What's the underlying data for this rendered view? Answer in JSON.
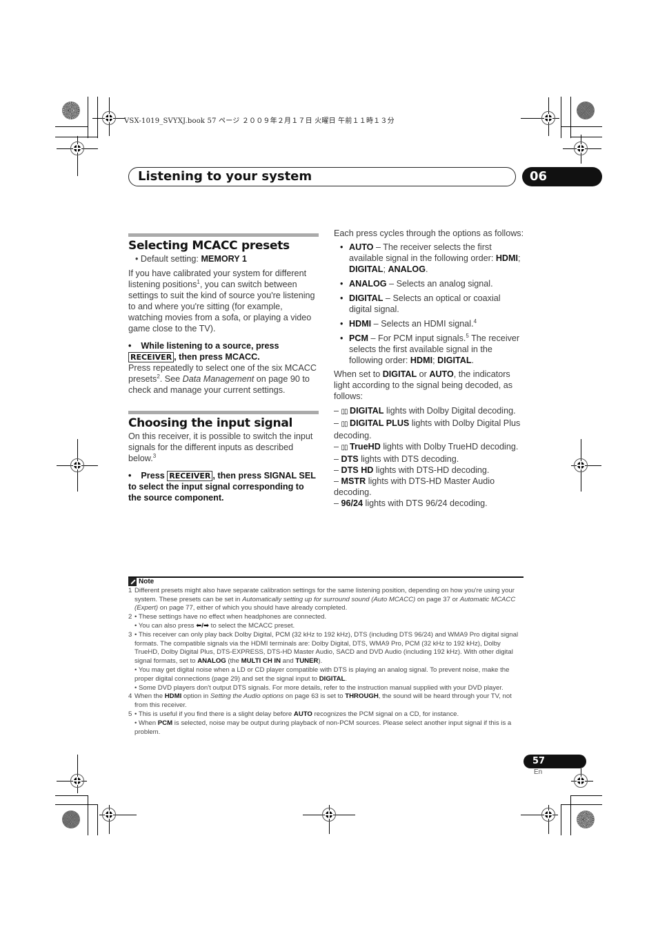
{
  "slug": "VSX-1019_SVYXJ.book  57 ページ  ２００９年２月１７日  火曜日  午前１１時１３分",
  "chapter": {
    "title": "Listening to your system",
    "number": "06"
  },
  "section1": {
    "heading": "Selecting MCACC presets",
    "default_label": "Default setting: ",
    "default_value": "MEMORY 1",
    "para_a": "If you have calibrated your system for different listening positions",
    "para_a_sup": "1",
    "para_b": ", you can switch between settings to suit the kind of source you're listening to and where you're sitting (for example, watching movies from a sofa, or playing a video game close to the TV).",
    "inst_pre": "While listening to a source, press ",
    "inst_key": "RECEIVER",
    "inst_post": ", then press MCACC.",
    "after_a": "Press repeatedly to select one of the six MCACC presets",
    "after_sup": "2",
    "after_b": ". See ",
    "after_italic": "Data Management",
    "after_c": " on page 90 to check and manage your current settings."
  },
  "section2": {
    "heading": "Choosing the input signal",
    "para": "On this receiver, it is possible to switch the input signals for the different inputs as described below.",
    "para_sup": "3",
    "inst_pre": "Press ",
    "inst_key": "RECEIVER",
    "inst_post": ", then press SIGNAL SEL to select the input signal corresponding to the source component."
  },
  "right": {
    "intro": "Each press cycles through the options as follows:",
    "options": [
      {
        "name": "AUTO",
        "desc": " – The receiver selects the first available signal in the following order: ",
        "order": [
          "HDMI",
          "DIGITAL",
          "ANALOG"
        ],
        "sup": ""
      },
      {
        "name": "ANALOG",
        "desc": " – Selects an analog signal.",
        "order": [],
        "sup": ""
      },
      {
        "name": "DIGITAL",
        "desc": " – Selects an optical or coaxial digital signal.",
        "order": [],
        "sup": ""
      },
      {
        "name": "HDMI",
        "desc": " – Selects an HDMI signal.",
        "order": [],
        "sup": "4"
      },
      {
        "name": "PCM",
        "desc": " – For PCM input signals.",
        "order": [
          "HDMI",
          "DIGITAL"
        ],
        "sup": "5",
        "desc2": " The receiver selects the first available signal in the following order: "
      }
    ],
    "when_pre": "When set to ",
    "when_b1": "DIGITAL",
    "when_mid": " or ",
    "when_b2": "AUTO",
    "when_post": ", the indicators light according to the signal being decoded, as follows:",
    "indicators": [
      {
        "dolby": true,
        "label": "DIGITAL",
        "desc": " lights with Dolby Digital decoding."
      },
      {
        "dolby": true,
        "label": "DIGITAL PLUS",
        "desc": " lights with Dolby Digital Plus decoding."
      },
      {
        "dolby": true,
        "label": "TrueHD",
        "desc": " lights with Dolby TrueHD decoding."
      },
      {
        "dolby": false,
        "label": "DTS",
        "desc": " lights with DTS decoding."
      },
      {
        "dolby": false,
        "label": "DTS HD",
        "desc": " lights with DTS-HD decoding."
      },
      {
        "dolby": false,
        "label": "MSTR",
        "desc": " lights with DTS-HD Master Audio decoding."
      },
      {
        "dolby": false,
        "label": "96/24",
        "desc": " lights with DTS 96/24 decoding."
      }
    ]
  },
  "notes": {
    "heading": "Note",
    "n1_num": "1",
    "n1_a": "Different presets might also have separate calibration settings for the same listening position, depending on how you're using your system. These presets can be set in ",
    "n1_i1": "Automatically setting up for surround sound (Auto MCACC)",
    "n1_b": " on page 37 or ",
    "n1_i2": "Automatic MCACC (Expert)",
    "n1_c": " on page 77, either of which you should have already completed.",
    "n2_num": "2",
    "n2_a": "• These settings have no effect when headphones are connected.",
    "n2_b_pre": "• You can also press ",
    "n2_b_arrows": "⬅/➡",
    "n2_b_post": " to select the MCACC preset.",
    "n3_num": "3",
    "n3_a": "• This receiver can only play back Dolby Digital, PCM (32 kHz to 192 kHz), DTS (including DTS 96/24) and WMA9 Pro digital signal formats. The compatible signals via the HDMI terminals are: Dolby Digital, DTS, WMA9 Pro, PCM (32 kHz to 192 kHz), Dolby TrueHD, Dolby Digital Plus, DTS-EXPRESS, DTS-HD Master Audio, SACD and DVD Audio (including 192 kHz). With other digital signal formats, set to ",
    "n3_a_b1": "ANALOG",
    "n3_a_mid": " (the ",
    "n3_a_b2": "MULTI CH IN",
    "n3_a_and": " and ",
    "n3_a_b3": "TUNER",
    "n3_a_end": ").",
    "n3_b": "• You may get digital noise when a LD or CD player compatible with DTS is playing an analog signal. To prevent noise, make the proper digital connections (page 29) and set the signal input to ",
    "n3_b_b": "DIGITAL",
    "n3_b_end": ".",
    "n3_c": "• Some DVD players don't output DTS signals. For more details, refer to the instruction manual supplied with your DVD player.",
    "n4_num": "4",
    "n4_a": "When the ",
    "n4_b1": "HDMI",
    "n4_b": " option in ",
    "n4_i": "Setting the Audio options",
    "n4_c": " on page 63 is set to ",
    "n4_b2": "THROUGH",
    "n4_d": ", the sound will be heard through your TV, not from this receiver.",
    "n5_num": "5",
    "n5_a": "• This is useful if you find there is a slight delay before ",
    "n5_a_b": "AUTO",
    "n5_a_end": " recognizes the PCM signal on a CD, for instance.",
    "n5_b_pre": "• When ",
    "n5_b_b": "PCM",
    "n5_b_end": " is selected, noise may be output during playback of non-PCM sources. Please select another input signal if this is a problem."
  },
  "footer": {
    "page": "57",
    "lang": "En"
  }
}
